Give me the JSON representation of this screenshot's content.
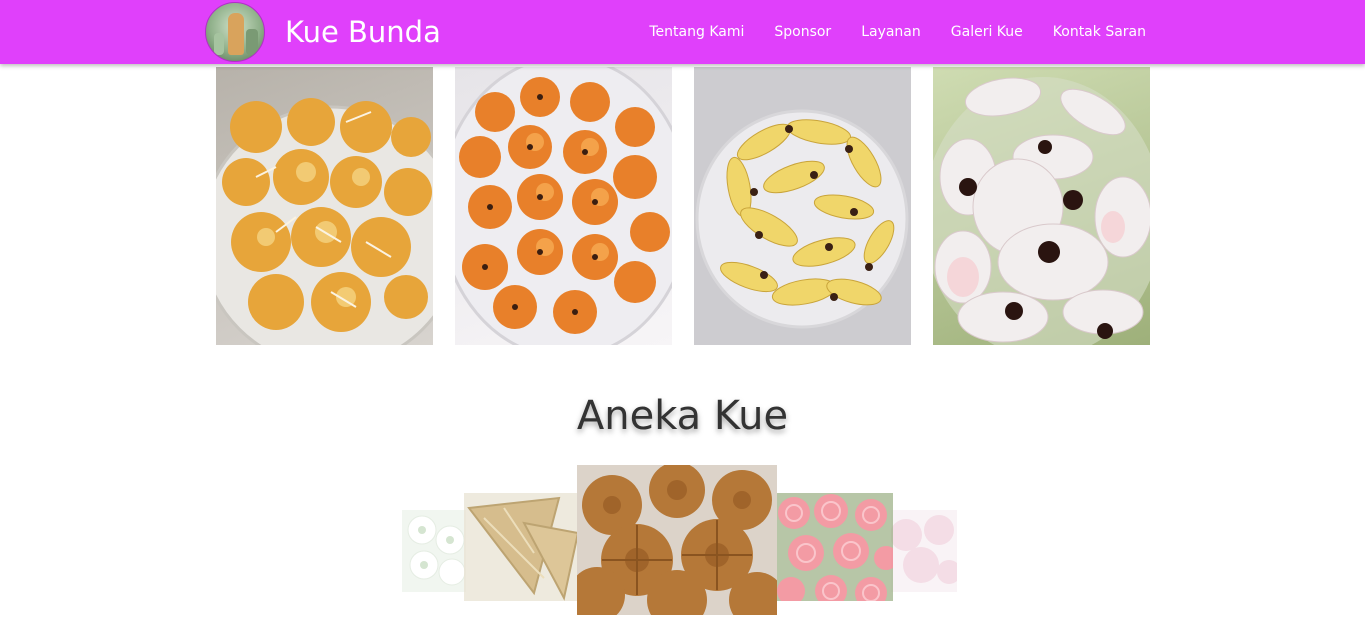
{
  "navbar": {
    "brand": "Kue Bunda",
    "links": [
      "Tentang Kami",
      "Sponsor",
      "Layanan",
      "Galeri Kue",
      "Kontak Saran"
    ],
    "background_color": "#e040fb"
  },
  "gallery": {
    "photos": [
      {
        "alt": "nastar-cookies-photo"
      },
      {
        "alt": "orange-shaped-cookies-photo"
      },
      {
        "alt": "banana-cookies-photo"
      },
      {
        "alt": "white-crescent-cookies-photo"
      }
    ]
  },
  "section": {
    "title": "Aneka Kue"
  },
  "carousel": {
    "slides": [
      {
        "alt": "white-flower-cookies-photo"
      },
      {
        "alt": "triangle-pastry-photo"
      },
      {
        "alt": "brown-sponge-cake-photo"
      },
      {
        "alt": "pink-rose-cupcakes-photo"
      },
      {
        "alt": "pink-cookies-photo"
      }
    ]
  }
}
